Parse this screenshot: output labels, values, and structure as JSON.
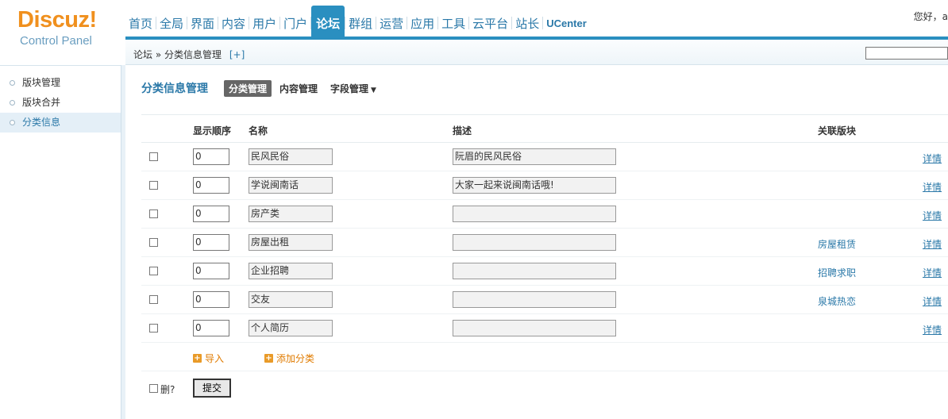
{
  "logo": {
    "brand": "Discuz!",
    "subtitle": "Control Panel"
  },
  "nav": {
    "items": [
      {
        "label": "首页"
      },
      {
        "label": "全局"
      },
      {
        "label": "界面"
      },
      {
        "label": "内容"
      },
      {
        "label": "用户"
      },
      {
        "label": "门户"
      },
      {
        "label": "论坛",
        "active": true
      },
      {
        "label": "群组"
      },
      {
        "label": "运营"
      },
      {
        "label": "应用"
      },
      {
        "label": "工具"
      },
      {
        "label": "云平台"
      },
      {
        "label": "站长"
      },
      {
        "label": "UCenter"
      }
    ]
  },
  "header": {
    "greeting": "您好，a"
  },
  "breadcrumb": {
    "root": "论坛",
    "separator": "»",
    "current": "分类信息管理",
    "add_label": "[+]"
  },
  "sidebar": {
    "items": [
      {
        "label": "版块管理"
      },
      {
        "label": "版块合并"
      },
      {
        "label": "分类信息",
        "active": true
      }
    ]
  },
  "main": {
    "title": "分类信息管理",
    "tabs": [
      {
        "label": "分类管理",
        "active": true
      },
      {
        "label": "内容管理"
      },
      {
        "label": "字段管理",
        "arrow": "▼"
      }
    ]
  },
  "table": {
    "headers": {
      "order": "显示顺序",
      "name": "名称",
      "desc": "描述",
      "related": "关联版块"
    },
    "rows": [
      {
        "order": "0",
        "name": "民风民俗",
        "desc": "阮眉的民风民俗",
        "related": "",
        "detail": "详情"
      },
      {
        "order": "0",
        "name": "学说闽南话",
        "desc": "大家一起来说闽南话哦!",
        "related": "",
        "detail": "详情"
      },
      {
        "order": "0",
        "name": "房产类",
        "desc": "",
        "related": "",
        "detail": "详情"
      },
      {
        "order": "0",
        "name": "房屋出租",
        "desc": "",
        "related": "房屋租赁",
        "detail": "详情"
      },
      {
        "order": "0",
        "name": "企业招聘",
        "desc": "",
        "related": "招聘求职",
        "detail": "详情"
      },
      {
        "order": "0",
        "name": "交友",
        "desc": "",
        "related": "泉城热恋",
        "detail": "详情"
      },
      {
        "order": "0",
        "name": "个人简历",
        "desc": "",
        "related": "",
        "detail": "详情"
      }
    ],
    "actions": {
      "import_label": "导入",
      "add_label": "添加分类"
    }
  },
  "footer": {
    "delete_label": "删?",
    "submit_label": "提交"
  },
  "colors": {
    "accent": "#2a8fc0",
    "link": "#2a78a8",
    "logo": "#f0901e",
    "action": "#e07b00"
  }
}
